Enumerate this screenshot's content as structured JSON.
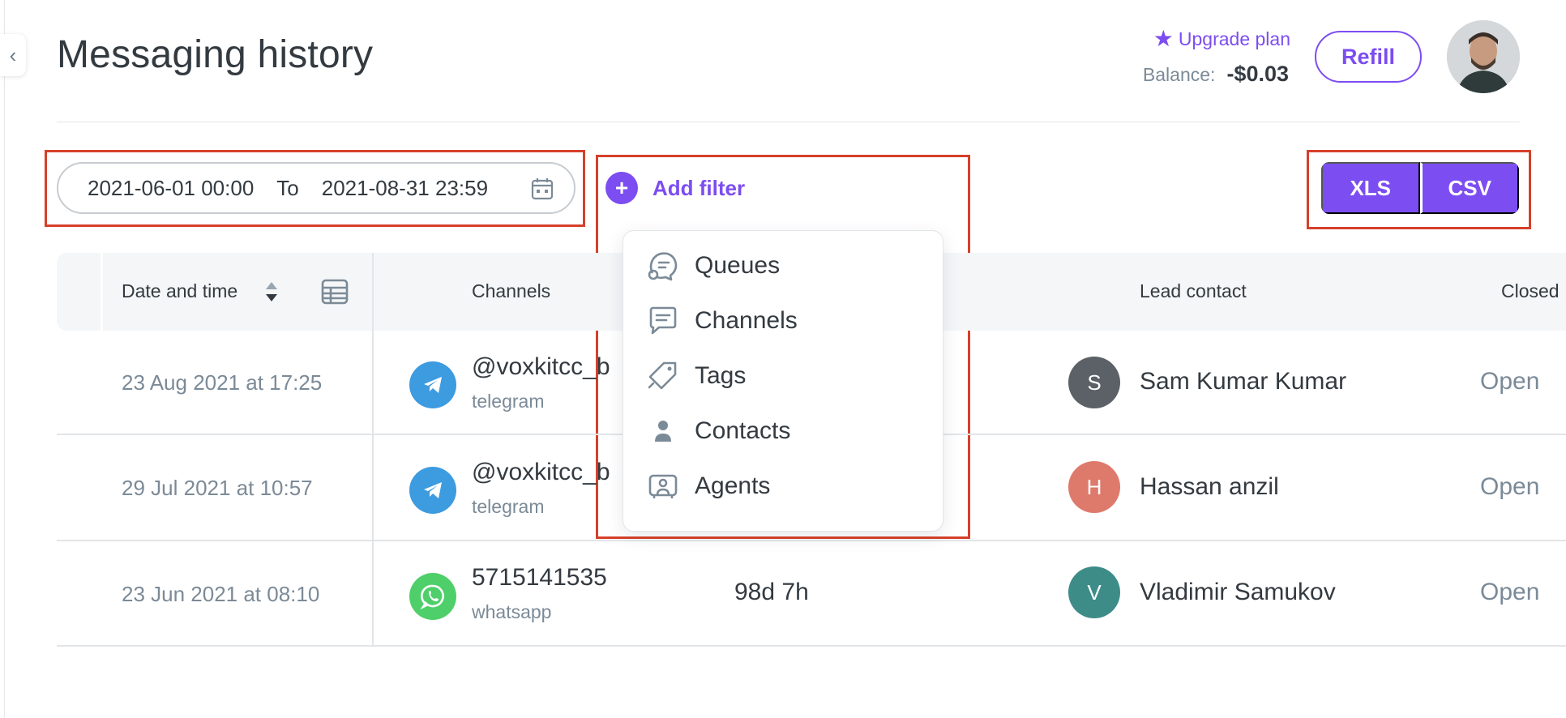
{
  "page": {
    "title": "Messaging history"
  },
  "header": {
    "upgrade_label": "Upgrade plan",
    "balance_label": "Balance:",
    "balance_value": "-$0.03",
    "refill_label": "Refill"
  },
  "filters": {
    "date_from": "2021-06-01 00:00",
    "date_to_label": "To",
    "date_to": "2021-08-31 23:59",
    "add_filter_label": "Add filter",
    "dropdown_items": [
      "Queues",
      "Channels",
      "Tags",
      "Contacts",
      "Agents"
    ]
  },
  "export": {
    "xls_label": "XLS",
    "csv_label": "CSV"
  },
  "table": {
    "columns": {
      "date": "Date and time",
      "channels": "Channels",
      "lead": "Lead contact",
      "closed": "Closed"
    },
    "rows": [
      {
        "date": "23 Aug 2021 at 17:25",
        "channel_name": "@voxkitcc_b",
        "channel_type": "telegram",
        "duration": "",
        "lead_initial": "S",
        "lead_name": "Sam Kumar Kumar",
        "status": "Open"
      },
      {
        "date": "29 Jul 2021 at 10:57",
        "channel_name": "@voxkitcc_b",
        "channel_type": "telegram",
        "duration": "",
        "lead_initial": "H",
        "lead_name": "Hassan anzil",
        "status": "Open"
      },
      {
        "date": "23 Jun 2021 at 08:10",
        "channel_name": "5715141535",
        "channel_type": "whatsapp",
        "duration": "98d 7h",
        "lead_initial": "V",
        "lead_name": "Vladimir Samukov",
        "status": "Open"
      }
    ]
  },
  "colors": {
    "accent": "#7c4df1",
    "highlight": "#d6402a",
    "telegram": "#3d9be0",
    "whatsapp": "#4fcf6a",
    "avatar_s": "#5b6166",
    "avatar_h": "#de7a6c",
    "avatar_v": "#3d8c88"
  },
  "icons": [
    "chevron-left-icon",
    "star-icon",
    "calendar-icon",
    "plus-icon",
    "sort-icon",
    "columns-icon",
    "telegram-icon",
    "whatsapp-icon",
    "queues-icon",
    "channels-icon",
    "tags-icon",
    "contacts-icon",
    "agents-icon"
  ]
}
